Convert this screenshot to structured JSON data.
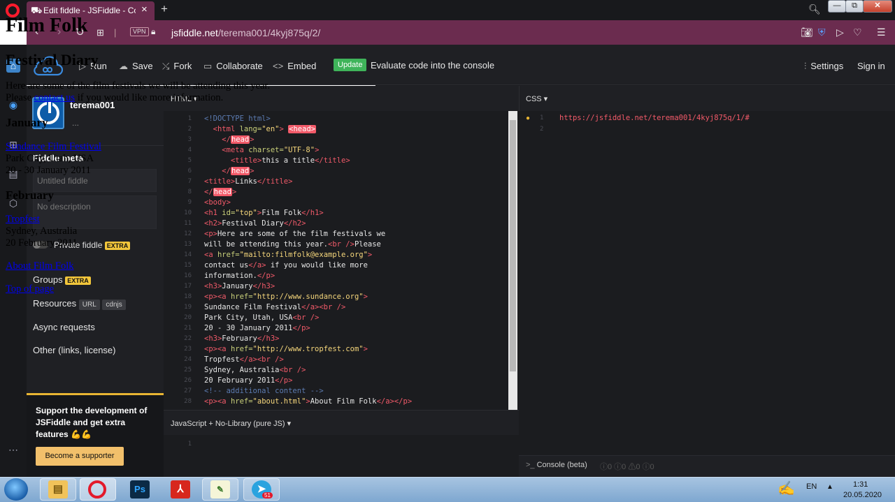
{
  "browser": {
    "tab_title": "Edit fiddle - JSFiddle - Code Playground",
    "vpn": "VPN",
    "url_host": "jsfiddle.net",
    "url_path": "/terema001/4kyj875q/2/"
  },
  "header": {
    "run": "Run",
    "save": "Save",
    "fork": "Fork",
    "collaborate": "Collaborate",
    "embed": "Embed",
    "update": "Update",
    "eval_text": "Evaluate code into the console",
    "settings": "Settings",
    "signin": "Sign in"
  },
  "sidebar": {
    "username": "terema001",
    "user_sub": "...",
    "meta_title": "Fiddle meta",
    "title_placeholder": "Untitled fiddle",
    "desc_placeholder": "No description",
    "private_label": "Private fiddle",
    "extra": "EXTRA",
    "groups": "Groups",
    "resources": "Resources",
    "url_pill": "URL",
    "cdnjs_pill": "cdnjs",
    "async": "Async requests",
    "other": "Other (links, license)",
    "support_text": "Support the development of JSFiddle and get extra features 💪💪",
    "support_btn": "Become a supporter"
  },
  "html_panel": {
    "label": "HTML ▾"
  },
  "js_panel": {
    "label": "JavaScript + No-Library (pure JS) ▾",
    "line1": "1"
  },
  "css_panel": {
    "label": "CSS ▾",
    "line1_num": "1",
    "line2_num": "2",
    "line1_text": "https://jsfiddle.net/terema001/4kyj875q/1/#"
  },
  "result": {
    "h1": "Film Folk",
    "h2": "Festival Diary",
    "intro_1": "Here are some of the film festivals we will be attending this year.",
    "intro_2": "Please ",
    "contact_link": "contact us",
    "intro_3": " if you would like more information.",
    "jan_h": "January",
    "jan_link": "Sundance Film Festival",
    "jan_place": "Park City, Utah, USA",
    "jan_date": "20 - 30 January 2011",
    "feb_h": "February",
    "feb_link": "Tropfest",
    "feb_place": "Sydney, Australia",
    "feb_date": "20 February 2011",
    "about_link": "About Film Folk",
    "top_link": "Top of page"
  },
  "console": {
    "label": "Console (beta)",
    "counts": "ⓘ0  ⓘ0  ⚠0  ⓘ0"
  },
  "taskbar": {
    "lang": "EN",
    "time": "1:31",
    "date": "20.05.2020",
    "telegram_badge": "51"
  }
}
